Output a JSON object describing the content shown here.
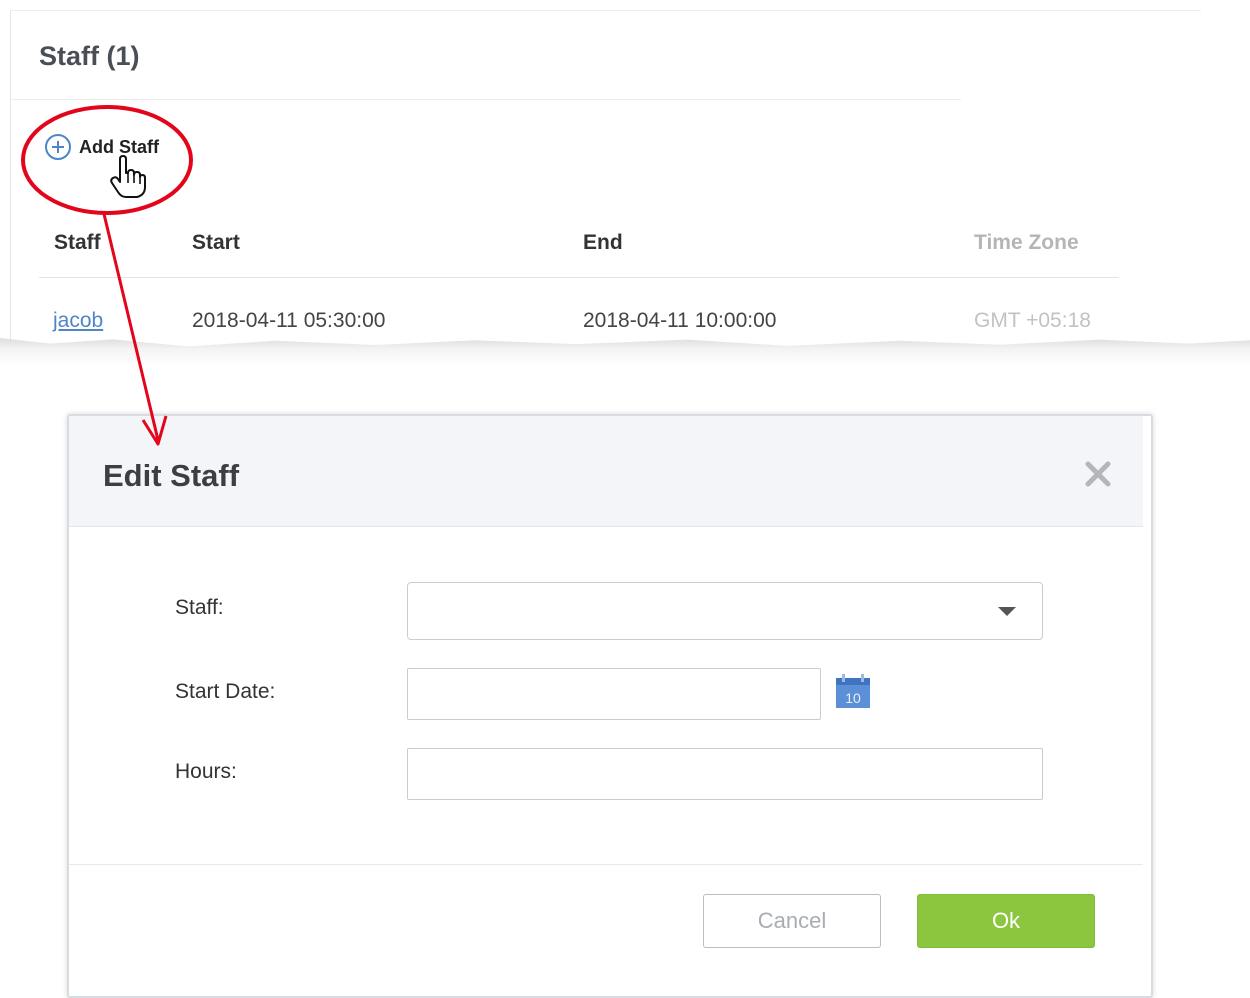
{
  "panel": {
    "title": "Staff (1)",
    "add_label": "Add Staff"
  },
  "table": {
    "headers": [
      "Staff",
      "Start",
      "End",
      "Time Zone"
    ],
    "rows": [
      {
        "staff": "jacob",
        "start": "2018-04-11 05:30:00",
        "end": "2018-04-11 10:00:00",
        "timezone": "GMT +05:18"
      }
    ]
  },
  "dialog": {
    "title": "Edit Staff",
    "close_icon": "close-icon",
    "fields": {
      "staff_label": "Staff:",
      "staff_value": "",
      "start_date_label": "Start Date:",
      "start_date_value": "",
      "hours_label": "Hours:",
      "hours_value": ""
    },
    "calendar_day": "10",
    "cancel_label": "Cancel",
    "ok_label": "Ok"
  },
  "colors": {
    "accent_blue": "#4c86c6",
    "ok_green": "#8cc63f",
    "annotation_red": "#e3051b"
  }
}
